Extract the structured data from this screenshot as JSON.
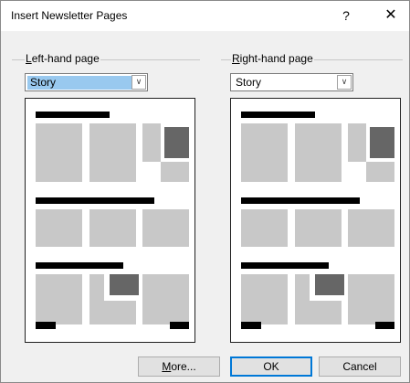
{
  "dialog": {
    "title": "Insert Newsletter Pages",
    "help_glyph": "?",
    "close_glyph": "✕"
  },
  "left_page": {
    "label_mnemonic": "L",
    "label_rest": "eft-hand page",
    "selected": "Story"
  },
  "right_page": {
    "label_mnemonic": "R",
    "label_rest": "ight-hand page",
    "selected": "Story"
  },
  "buttons": {
    "more_mnemonic": "M",
    "more_rest": "ore...",
    "ok": "OK",
    "cancel": "Cancel"
  },
  "colors": {
    "selection": "#99c9ef",
    "ok_border": "#0078d7",
    "placeholder_gray": "#c8c8c8",
    "picture_gray": "#666666"
  },
  "icons": {
    "combo_arrow": "chevron-down-icon"
  }
}
